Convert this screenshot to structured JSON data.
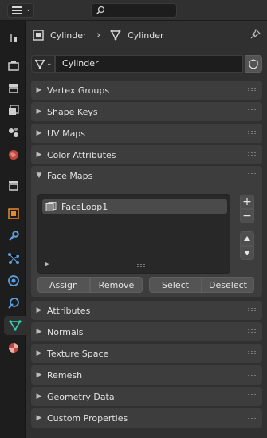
{
  "header": {
    "editor_type_icon": "properties-editor-icon",
    "search_icon": "search-icon"
  },
  "tabs": [
    {
      "name": "tool-tab",
      "icon": "tool-icon",
      "active": false
    },
    {
      "name": "render-tab",
      "icon": "render-icon",
      "active": false
    },
    {
      "name": "output-tab",
      "icon": "output-icon",
      "active": false
    },
    {
      "name": "view-layer-tab",
      "icon": "view-layer-icon",
      "active": false
    },
    {
      "name": "scene-tab",
      "icon": "scene-icon",
      "active": false
    },
    {
      "name": "world-tab",
      "icon": "world-icon",
      "active": false
    },
    {
      "name": "collection-tab",
      "icon": "collection-icon",
      "active": false
    },
    {
      "name": "object-tab",
      "icon": "object-icon",
      "active": false
    },
    {
      "name": "modifiers-tab",
      "icon": "wrench-icon",
      "active": false
    },
    {
      "name": "particles-tab",
      "icon": "particles-icon",
      "active": false
    },
    {
      "name": "physics-tab",
      "icon": "physics-icon",
      "active": false
    },
    {
      "name": "constraints-tab",
      "icon": "constraints-icon",
      "active": false
    },
    {
      "name": "data-tab",
      "icon": "mesh-data-icon",
      "active": true
    },
    {
      "name": "material-tab",
      "icon": "material-icon",
      "active": false
    }
  ],
  "breadcrumb": {
    "object_name": "Cylinder",
    "mesh_name": "Cylinder"
  },
  "datablock": {
    "name": "Cylinder"
  },
  "panels_top": [
    "Vertex Groups",
    "Shape Keys",
    "UV Maps",
    "Color Attributes"
  ],
  "face_maps": {
    "title": "Face Maps",
    "items": [
      "FaceLoop1"
    ],
    "add_label": "+",
    "remove_label": "−",
    "assign_label": "Assign",
    "remove_button_label": "Remove",
    "select_label": "Select",
    "deselect_label": "Deselect"
  },
  "panels_bottom": [
    "Attributes",
    "Normals",
    "Texture Space",
    "Remesh",
    "Geometry Data",
    "Custom Properties"
  ],
  "colors": {
    "accent_mesh": "#2fd5b4",
    "object_orange": "#e88a2e",
    "background": "#303030"
  }
}
